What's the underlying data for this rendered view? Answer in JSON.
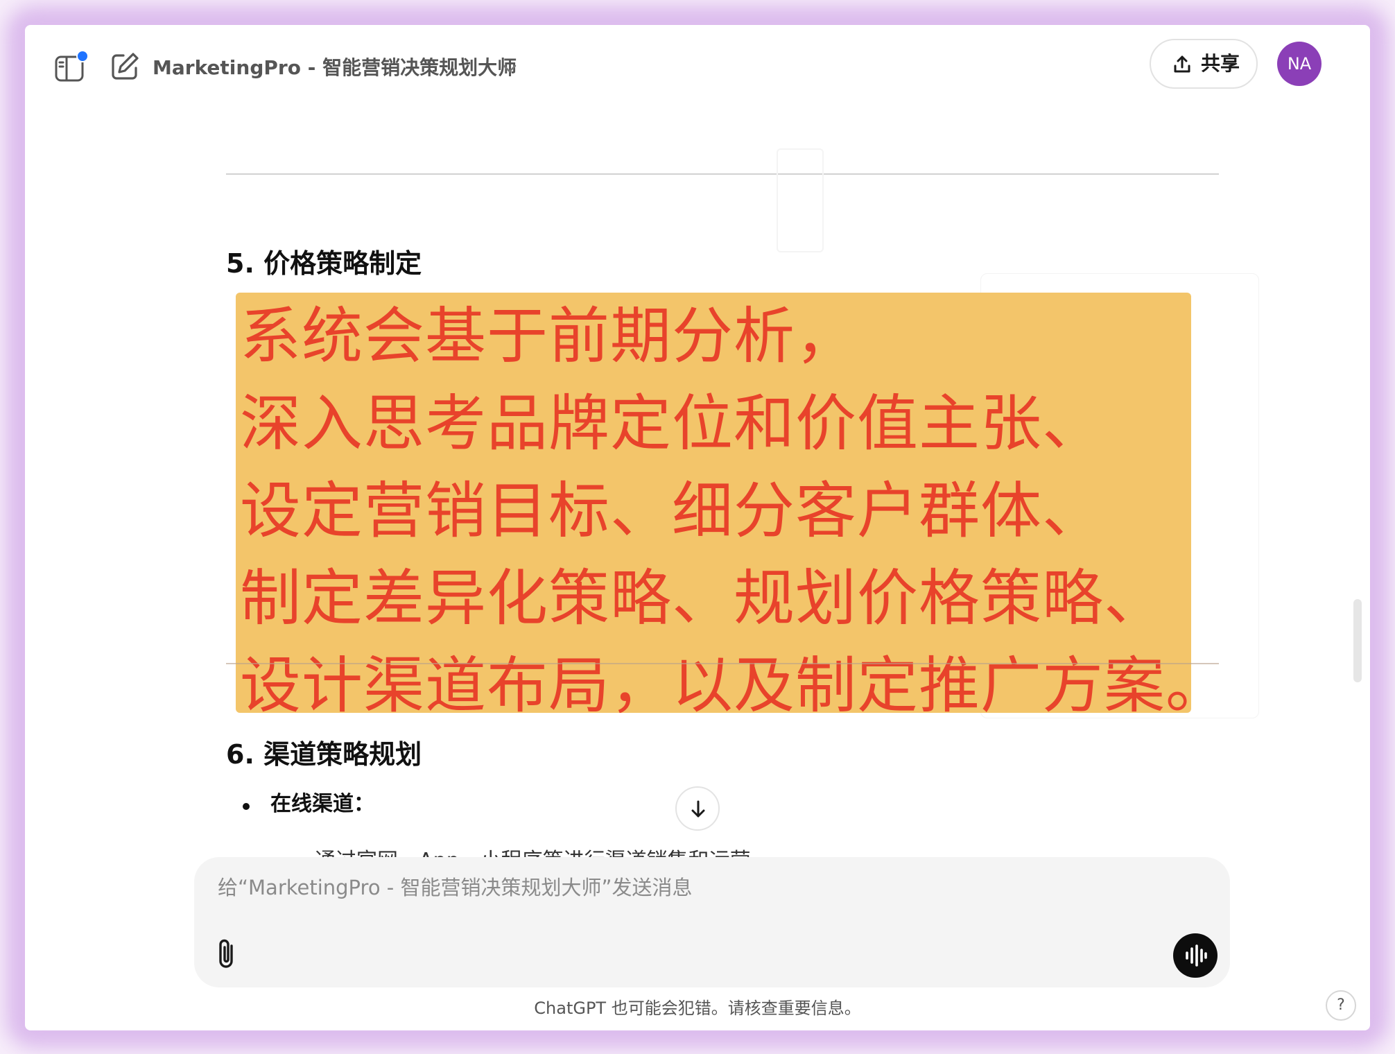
{
  "header": {
    "title": "MarketingPro - 智能营销决策规划大师",
    "share_label": "共享",
    "avatar_initials": "NA"
  },
  "content": {
    "section5_heading": "5. 价格策略制定",
    "highlight_lines": [
      "系统会基于前期分析，",
      "深入思考品牌定位和价值主张、",
      "设定营销目标、细分客户群体、",
      "制定差异化策略、规划价格策略、",
      "设计渠道布局，以及制定推广方案。"
    ],
    "section6_heading": "6. 渠道策略规划",
    "bullet_online": "在线渠道：",
    "cutoff_text": "通过官网、App、小程序等进行渠道销售和运营"
  },
  "composer": {
    "placeholder": "给“MarketingPro - 智能营销决策规划大师”发送消息"
  },
  "footer": {
    "disclaimer": "ChatGPT 也可能会犯错。请核查重要信息。",
    "help_label": "?"
  },
  "colors": {
    "highlight_bg": "#f3c56a",
    "highlight_text": "#e8432b",
    "avatar_bg": "#8b3fb7",
    "notification_dot": "#1f73ff"
  },
  "icons": [
    "sidebar-toggle-icon",
    "new-chat-icon",
    "chevron-down-icon",
    "share-icon",
    "arrow-down-icon",
    "paperclip-icon",
    "voice-waveform-icon"
  ]
}
